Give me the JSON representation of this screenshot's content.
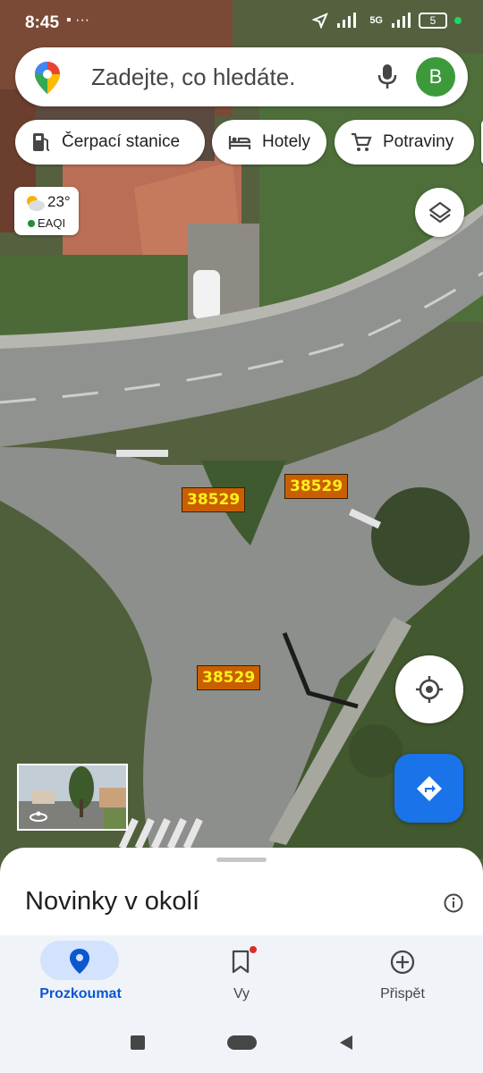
{
  "status_bar": {
    "time": "8:45",
    "left_icons": "▪ ···",
    "network": "5G",
    "battery": "5"
  },
  "search": {
    "placeholder": "Zadejte, co hledáte.",
    "avatar_letter": "B"
  },
  "chips": [
    {
      "label": "Čerpací stanice",
      "icon": "gas-station-icon"
    },
    {
      "label": "Hotely",
      "icon": "bed-icon"
    },
    {
      "label": "Potraviny",
      "icon": "cart-icon"
    }
  ],
  "weather": {
    "temperature": "23°",
    "aqi_label": "EAQI"
  },
  "road_labels": [
    "38529",
    "38529",
    "38529"
  ],
  "sheet": {
    "title": "Novinky v okolí"
  },
  "nav": {
    "items": [
      {
        "label": "Prozkoumat",
        "icon": "location-pin-icon",
        "active": true
      },
      {
        "label": "Vy",
        "icon": "bookmark-icon",
        "active": false
      },
      {
        "label": "Přispět",
        "icon": "add-circle-icon",
        "active": false
      }
    ]
  },
  "colors": {
    "primary_blue": "#1a73e8",
    "road_label_bg": "#c95f00",
    "road_label_text": "#ffef1a",
    "avatar_green": "#3c9a3a"
  }
}
